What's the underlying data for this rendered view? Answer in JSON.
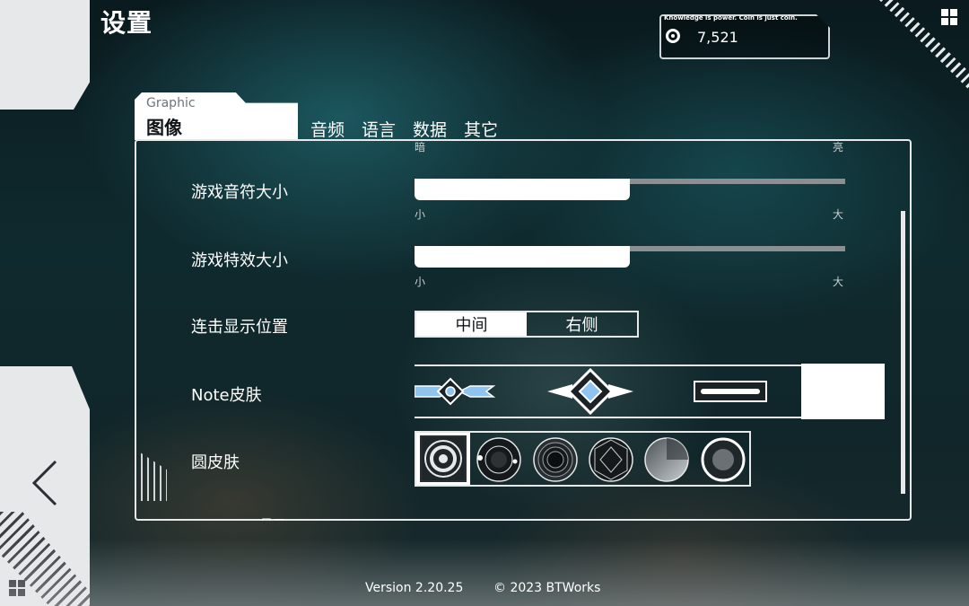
{
  "page": {
    "title": "设置"
  },
  "coins": {
    "tagline": "Knowledge is power. Coin is just coin.",
    "value": "7,521",
    "icon": "coin-icon"
  },
  "tabs": {
    "active": {
      "sub": "Graphic",
      "label": "图像"
    },
    "others": [
      "音频",
      "语言",
      "数据",
      "其它"
    ]
  },
  "settings": {
    "brightness": {
      "min_label": "暗",
      "max_label": "亮"
    },
    "note_size": {
      "label": "游戏音符大小",
      "min_label": "小",
      "max_label": "大",
      "value_fraction": 0.5
    },
    "effect_size": {
      "label": "游戏特效大小",
      "min_label": "小",
      "max_label": "大",
      "value_fraction": 0.5
    },
    "combo_position": {
      "label": "连击显示位置",
      "options": [
        "中间",
        "右侧"
      ],
      "selected": "中间"
    },
    "note_skin": {
      "label": "Note皮肤",
      "options": [
        "note-skin-1",
        "note-skin-2",
        "note-skin-3",
        "note-skin-4"
      ],
      "selected_index": 3
    },
    "circle_skin": {
      "label": "圆皮肤",
      "options": [
        "circle-skin-1",
        "circle-skin-2",
        "circle-skin-3",
        "circle-skin-4",
        "circle-skin-5",
        "circle-skin-6"
      ],
      "selected_index": 0
    },
    "cut_off_label": "显示..."
  },
  "footer": {
    "version": "Version 2.20.25",
    "copyright": "© 2023 BTWorks"
  },
  "colors": {
    "accent": "#8fc4f0",
    "panel": "#e6e8ea",
    "text_dark": "#121517"
  }
}
